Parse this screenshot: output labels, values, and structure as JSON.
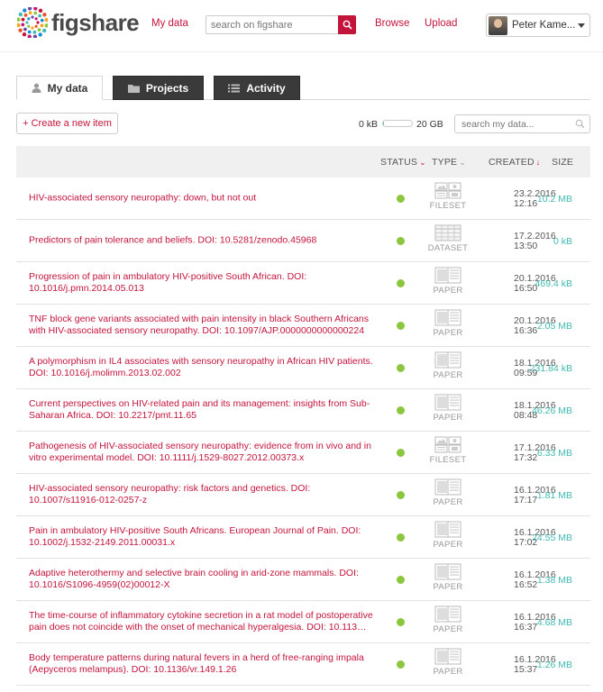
{
  "header": {
    "logo_text": "figshare",
    "nav_mydata": "My data",
    "search_placeholder": "search on figshare",
    "nav_browse": "Browse",
    "nav_upload": "Upload",
    "user_name": "Peter Kame..."
  },
  "tabs": [
    {
      "label": "My data",
      "icon": "user-icon"
    },
    {
      "label": "Projects",
      "icon": "folder-icon"
    },
    {
      "label": "Activity",
      "icon": "list-icon"
    }
  ],
  "toolbar": {
    "create_label": "+ Create a new item",
    "quota_used": "0 kB",
    "quota_total": "20 GB",
    "quota_fraction": 0.02,
    "search_placeholder": "search my data..."
  },
  "columns": {
    "status": "STATUS",
    "type": "TYPE",
    "created": "CREATED",
    "size": "SIZE"
  },
  "colors": {
    "accent": "#c3143c",
    "teal": "#40b9b2",
    "status_green": "#8cc63f"
  },
  "items": [
    {
      "title": "HIV-associated sensory neuropathy: down, but not out",
      "type": "FILESET",
      "date": "23.2.2016",
      "time": "12:16",
      "size": "10.2 MB"
    },
    {
      "title": "Predictors of pain tolerance and beliefs. DOI: 10.5281/zenodo.45968",
      "type": "DATASET",
      "date": "17.2.2016",
      "time": "13:50",
      "size": "0 kB"
    },
    {
      "title": "Progression of pain in ambulatory HIV-positive South African. DOI: 10.1016/j.pmn.2014.05.013",
      "type": "PAPER",
      "date": "20.1.2016",
      "time": "16:50",
      "size": "469.4 kB"
    },
    {
      "title": "TNF block gene variants associated with pain intensity in black Southern Africans with HIV-associated sensory neuropathy. DOI: 10.1097/AJP.0000000000000224",
      "type": "PAPER",
      "date": "20.1.2016",
      "time": "16:36",
      "size": "2.05 MB"
    },
    {
      "title": "A polymorphism in IL4 associates with sensory neuropathy in African HIV patients. DOI: 10.1016/j.molimm.2013.02.002",
      "type": "PAPER",
      "date": "18.1.2016",
      "time": "09:59",
      "size": "231.84 kB"
    },
    {
      "title": "Current perspectives on HIV-related pain and its management: insights from Sub-Saharan Africa. DOI: 10.2217/pmt.11.65",
      "type": "PAPER",
      "date": "18.1.2016",
      "time": "08:48",
      "size": "46.26 MB"
    },
    {
      "title": "Pathogenesis of HIV-associated sensory neuropathy: evidence from in vivo and in vitro experimental model. DOI: 10.1111/j.1529-8027.2012.00373.x",
      "type": "FILESET",
      "date": "17.1.2016",
      "time": "17:32",
      "size": "6.33 MB"
    },
    {
      "title": "HIV-associated sensory neuropathy: risk factors and genetics. DOI: 10.1007/s11916-012-0257-z",
      "type": "PAPER",
      "date": "16.1.2016",
      "time": "17:17",
      "size": "1.81 MB"
    },
    {
      "title": "Pain in ambulatory HIV-positive South Africans. European Journal of Pain. DOI: 10.1002/j.1532-2149.2011.00031.x",
      "type": "PAPER",
      "date": "16.1.2016",
      "time": "17:02",
      "size": "24.55 MB"
    },
    {
      "title": "Adaptive heterothermy and selective brain cooling in arid-zone mammals. DOI: 10.1016/S1096-4959(02)00012-X",
      "type": "PAPER",
      "date": "16.1.2016",
      "time": "16:52",
      "size": "1.38 MB"
    },
    {
      "title": "The time-course of inflammatory cytokine secretion in a rat model of postoperative pain does not coincide with the onset of mechanical hyperalgesia. DOI: 10.113…",
      "type": "PAPER",
      "date": "16.1.2016",
      "time": "16:37",
      "size": "4.68 MB"
    },
    {
      "title": "Body temperature patterns during natural fevers in a herd of free-ranging impala (Aepyceros melampus). DOI: 10.1136/vr.149.1.26",
      "type": "PAPER",
      "date": "16.1.2016",
      "time": "15:37",
      "size": "1.26 MB"
    }
  ]
}
